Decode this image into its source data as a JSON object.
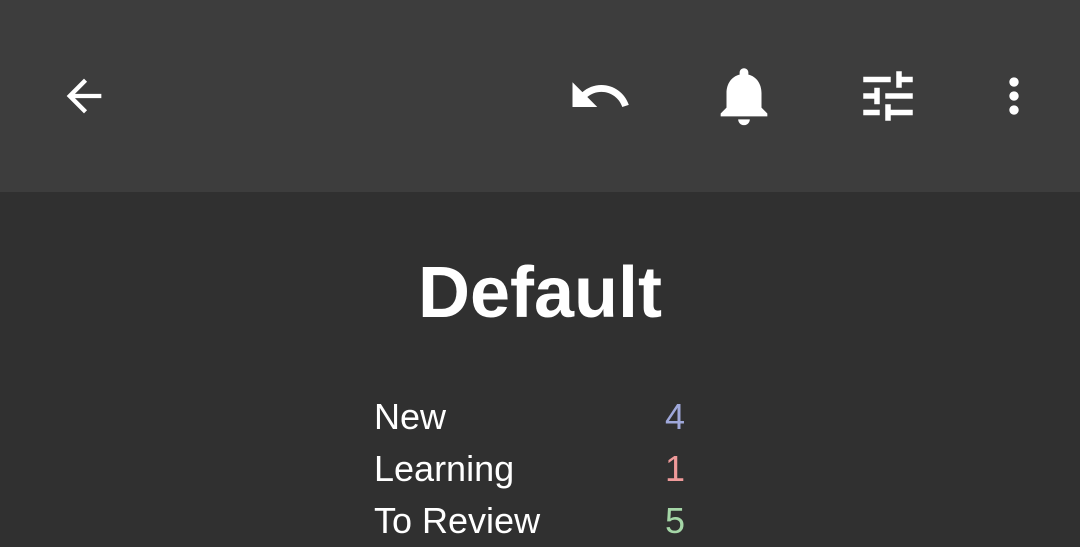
{
  "toolbar": {
    "back_icon": "arrow-left-icon",
    "undo_icon": "undo-icon",
    "reminder_icon": "bell-icon",
    "options_icon": "tune-sliders-icon",
    "more_icon": "more-vertical-icon"
  },
  "deck": {
    "title": "Default"
  },
  "counts": [
    {
      "label": "New",
      "value": "4",
      "color": "#9fa8da"
    },
    {
      "label": "Learning",
      "value": "1",
      "color": "#ef9a9a"
    },
    {
      "label": "To Review",
      "value": "5",
      "color": "#a5d6a7"
    }
  ],
  "colors": {
    "toolbar_bg": "#3d3d3d",
    "content_bg": "#303030",
    "text": "#ffffff"
  }
}
